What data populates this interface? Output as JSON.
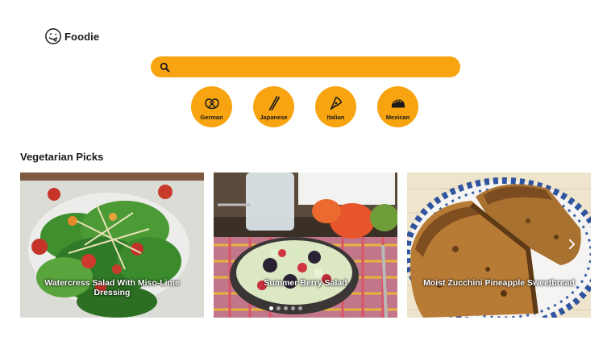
{
  "brand": {
    "name": "Foodie",
    "logo_icon": "smiley-tongue-icon"
  },
  "search": {
    "value": "",
    "placeholder": "",
    "icon": "search-icon"
  },
  "colors": {
    "accent": "#f7a410",
    "text": "#1a1a1a",
    "background": "#ffffff"
  },
  "cuisines": [
    {
      "label": "German",
      "icon": "pretzel-icon"
    },
    {
      "label": "Japanese",
      "icon": "chopsticks-icon"
    },
    {
      "label": "Italian",
      "icon": "pizza-icon"
    },
    {
      "label": "Mexican",
      "icon": "taco-icon"
    }
  ],
  "section": {
    "title": "Vegetarian Picks"
  },
  "recipes": [
    {
      "title": "Watercress Salad With Miso-Lime Dressing"
    },
    {
      "title": "Summer Berry Salad"
    },
    {
      "title": "Moist Zucchini Pineapple Sweetbread"
    }
  ],
  "carousel": {
    "pages": 5,
    "active_page": 1,
    "next_icon": "chevron-right-icon"
  }
}
